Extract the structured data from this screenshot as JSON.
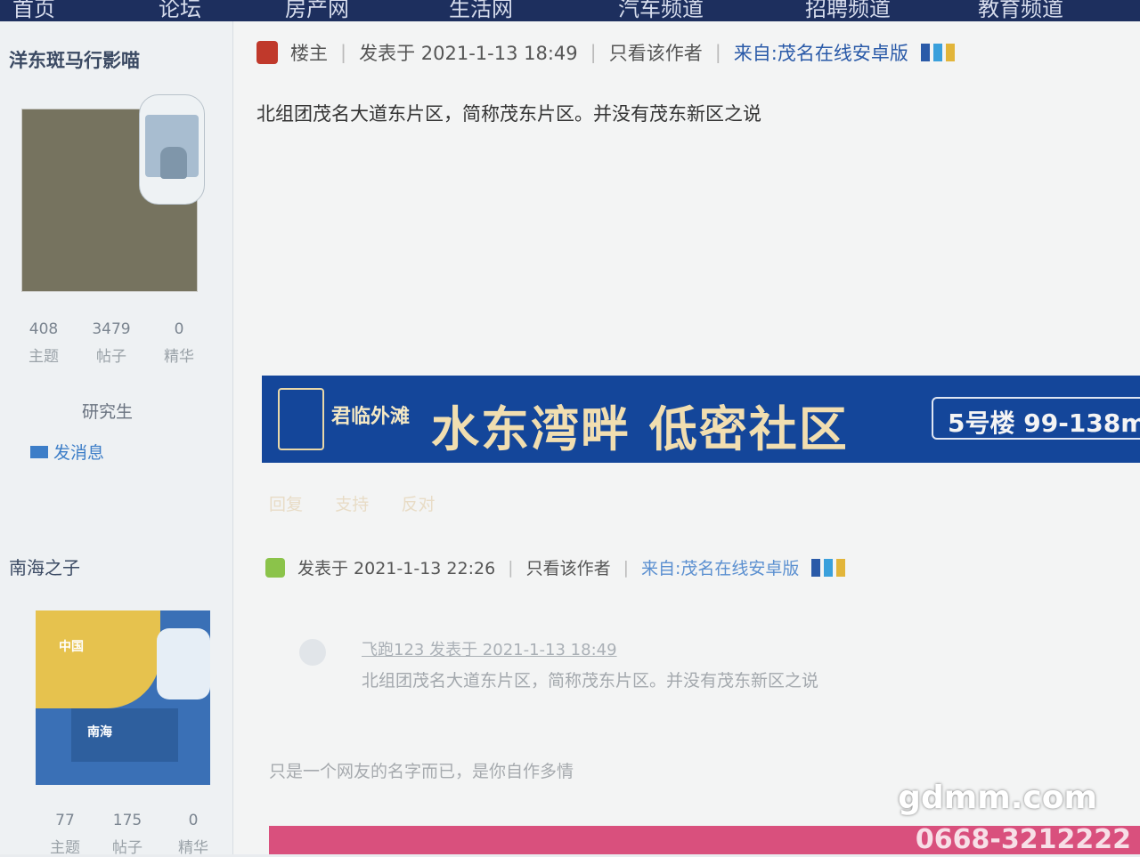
{
  "nav": {
    "items": [
      "首页",
      "论坛",
      "房产网",
      "生活网",
      "汽车频道",
      "招聘频道",
      "教育频道"
    ]
  },
  "post1": {
    "author": "洋东斑马行影喵",
    "stats": [
      {
        "value": "408",
        "label": "主题"
      },
      {
        "value": "3479",
        "label": "帖子"
      },
      {
        "value": "0",
        "label": "精华"
      }
    ],
    "rank": "研究生",
    "send_message": "发消息",
    "floor_label": "楼主",
    "posted_at": "发表于 2021-1-13 18:49",
    "only_author": "只看该作者",
    "source": "来自:茂名在线安卓版",
    "content": "北组团茂名大道东片区，简称茂东片区。并没有茂东新区之说"
  },
  "ad_banner": {
    "brand": "君临外滩",
    "slogan": "水东湾畔  低密社区",
    "spec": "5号楼 99-138m"
  },
  "post_actions": [
    "回复",
    "支持",
    "反对"
  ],
  "post2": {
    "author": "南海之子",
    "avatar_text": [
      "中国",
      "南海"
    ],
    "stats": [
      {
        "value": "77",
        "label": "主题"
      },
      {
        "value": "175",
        "label": "帖子"
      },
      {
        "value": "0",
        "label": "精华"
      }
    ],
    "posted_at": "发表于 2021-1-13 22:26",
    "only_author": "只看该作者",
    "source": "来自:茂名在线安卓版",
    "quote_header": "飞跑123 发表于 2021-1-13 18:49",
    "quote_body": "北组团茂名大道东片区，简称茂东片区。并没有茂东新区之说",
    "reply": "只是一个网友的名字而已，是你自作多情"
  },
  "footer_banner": {
    "phone": "0668-3212222"
  },
  "watermark": "gdmm.com",
  "colors": {
    "nav_bg": "#1d2f5e",
    "banner_bg": "#14469a",
    "link_blue": "#2a5aa8",
    "footer_pink": "#d9507d"
  }
}
